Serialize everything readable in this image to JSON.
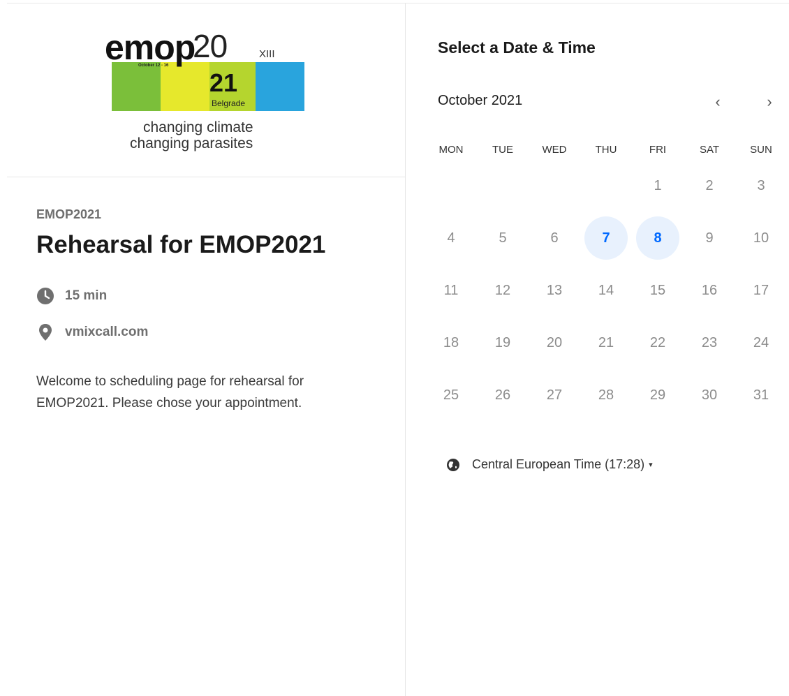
{
  "logo": {
    "word": "emop",
    "num_top": "20",
    "roman": "XIII",
    "dates": "October 12 - 16",
    "num_bottom": "21",
    "city": "Belgrade",
    "tagline1": "changing climate",
    "tagline2": "changing parasites",
    "colors": [
      "#7bbf3a",
      "#e6e82c",
      "#b5d52e",
      "#29a4dd"
    ]
  },
  "event": {
    "organizer": "EMOP2021",
    "title": "Rehearsal for EMOP2021",
    "duration": "15 min",
    "location": "vmixcall.com",
    "description": "Welcome to scheduling page for rehearsal for EMOP2021. Please chose your appointment.",
    "duration_icon": "clock-icon",
    "location_icon": "map-pin-icon"
  },
  "calendar": {
    "heading": "Select a Date & Time",
    "month_label": "October 2021",
    "prev_icon": "chevron-left-icon",
    "next_icon": "chevron-right-icon",
    "prev_glyph": "‹",
    "next_glyph": "›",
    "weekdays": [
      "MON",
      "TUE",
      "WED",
      "THU",
      "FRI",
      "SAT",
      "SUN"
    ],
    "first_weekday_index": 4,
    "days_in_month": 31,
    "available_days": [
      7,
      8
    ],
    "accent_color": "#0069ff",
    "available_bg": "#e8f1fd"
  },
  "timezone": {
    "label": "Central European Time (17:28)",
    "icon": "globe-icon",
    "caret_icon": "caret-down-icon",
    "caret": "▾"
  }
}
